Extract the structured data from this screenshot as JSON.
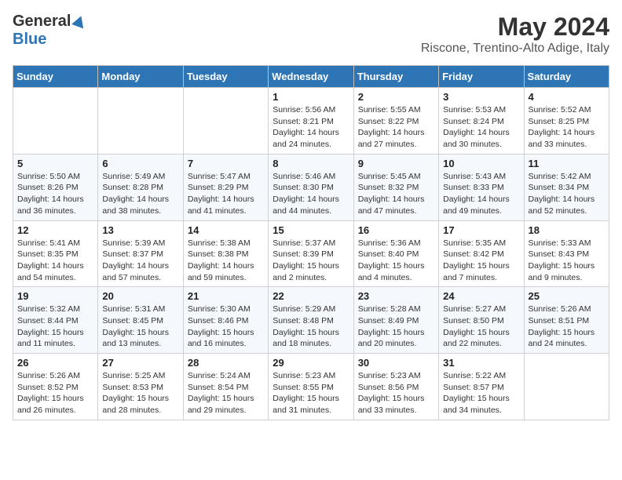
{
  "header": {
    "logo_general": "General",
    "logo_blue": "Blue",
    "month": "May 2024",
    "location": "Riscone, Trentino-Alto Adige, Italy"
  },
  "days_of_week": [
    "Sunday",
    "Monday",
    "Tuesday",
    "Wednesday",
    "Thursday",
    "Friday",
    "Saturday"
  ],
  "weeks": [
    [
      {
        "day": "",
        "sunrise": "",
        "sunset": "",
        "daylight": ""
      },
      {
        "day": "",
        "sunrise": "",
        "sunset": "",
        "daylight": ""
      },
      {
        "day": "",
        "sunrise": "",
        "sunset": "",
        "daylight": ""
      },
      {
        "day": "1",
        "sunrise": "Sunrise: 5:56 AM",
        "sunset": "Sunset: 8:21 PM",
        "daylight": "Daylight: 14 hours and 24 minutes."
      },
      {
        "day": "2",
        "sunrise": "Sunrise: 5:55 AM",
        "sunset": "Sunset: 8:22 PM",
        "daylight": "Daylight: 14 hours and 27 minutes."
      },
      {
        "day": "3",
        "sunrise": "Sunrise: 5:53 AM",
        "sunset": "Sunset: 8:24 PM",
        "daylight": "Daylight: 14 hours and 30 minutes."
      },
      {
        "day": "4",
        "sunrise": "Sunrise: 5:52 AM",
        "sunset": "Sunset: 8:25 PM",
        "daylight": "Daylight: 14 hours and 33 minutes."
      }
    ],
    [
      {
        "day": "5",
        "sunrise": "Sunrise: 5:50 AM",
        "sunset": "Sunset: 8:26 PM",
        "daylight": "Daylight: 14 hours and 36 minutes."
      },
      {
        "day": "6",
        "sunrise": "Sunrise: 5:49 AM",
        "sunset": "Sunset: 8:28 PM",
        "daylight": "Daylight: 14 hours and 38 minutes."
      },
      {
        "day": "7",
        "sunrise": "Sunrise: 5:47 AM",
        "sunset": "Sunset: 8:29 PM",
        "daylight": "Daylight: 14 hours and 41 minutes."
      },
      {
        "day": "8",
        "sunrise": "Sunrise: 5:46 AM",
        "sunset": "Sunset: 8:30 PM",
        "daylight": "Daylight: 14 hours and 44 minutes."
      },
      {
        "day": "9",
        "sunrise": "Sunrise: 5:45 AM",
        "sunset": "Sunset: 8:32 PM",
        "daylight": "Daylight: 14 hours and 47 minutes."
      },
      {
        "day": "10",
        "sunrise": "Sunrise: 5:43 AM",
        "sunset": "Sunset: 8:33 PM",
        "daylight": "Daylight: 14 hours and 49 minutes."
      },
      {
        "day": "11",
        "sunrise": "Sunrise: 5:42 AM",
        "sunset": "Sunset: 8:34 PM",
        "daylight": "Daylight: 14 hours and 52 minutes."
      }
    ],
    [
      {
        "day": "12",
        "sunrise": "Sunrise: 5:41 AM",
        "sunset": "Sunset: 8:35 PM",
        "daylight": "Daylight: 14 hours and 54 minutes."
      },
      {
        "day": "13",
        "sunrise": "Sunrise: 5:39 AM",
        "sunset": "Sunset: 8:37 PM",
        "daylight": "Daylight: 14 hours and 57 minutes."
      },
      {
        "day": "14",
        "sunrise": "Sunrise: 5:38 AM",
        "sunset": "Sunset: 8:38 PM",
        "daylight": "Daylight: 14 hours and 59 minutes."
      },
      {
        "day": "15",
        "sunrise": "Sunrise: 5:37 AM",
        "sunset": "Sunset: 8:39 PM",
        "daylight": "Daylight: 15 hours and 2 minutes."
      },
      {
        "day": "16",
        "sunrise": "Sunrise: 5:36 AM",
        "sunset": "Sunset: 8:40 PM",
        "daylight": "Daylight: 15 hours and 4 minutes."
      },
      {
        "day": "17",
        "sunrise": "Sunrise: 5:35 AM",
        "sunset": "Sunset: 8:42 PM",
        "daylight": "Daylight: 15 hours and 7 minutes."
      },
      {
        "day": "18",
        "sunrise": "Sunrise: 5:33 AM",
        "sunset": "Sunset: 8:43 PM",
        "daylight": "Daylight: 15 hours and 9 minutes."
      }
    ],
    [
      {
        "day": "19",
        "sunrise": "Sunrise: 5:32 AM",
        "sunset": "Sunset: 8:44 PM",
        "daylight": "Daylight: 15 hours and 11 minutes."
      },
      {
        "day": "20",
        "sunrise": "Sunrise: 5:31 AM",
        "sunset": "Sunset: 8:45 PM",
        "daylight": "Daylight: 15 hours and 13 minutes."
      },
      {
        "day": "21",
        "sunrise": "Sunrise: 5:30 AM",
        "sunset": "Sunset: 8:46 PM",
        "daylight": "Daylight: 15 hours and 16 minutes."
      },
      {
        "day": "22",
        "sunrise": "Sunrise: 5:29 AM",
        "sunset": "Sunset: 8:48 PM",
        "daylight": "Daylight: 15 hours and 18 minutes."
      },
      {
        "day": "23",
        "sunrise": "Sunrise: 5:28 AM",
        "sunset": "Sunset: 8:49 PM",
        "daylight": "Daylight: 15 hours and 20 minutes."
      },
      {
        "day": "24",
        "sunrise": "Sunrise: 5:27 AM",
        "sunset": "Sunset: 8:50 PM",
        "daylight": "Daylight: 15 hours and 22 minutes."
      },
      {
        "day": "25",
        "sunrise": "Sunrise: 5:26 AM",
        "sunset": "Sunset: 8:51 PM",
        "daylight": "Daylight: 15 hours and 24 minutes."
      }
    ],
    [
      {
        "day": "26",
        "sunrise": "Sunrise: 5:26 AM",
        "sunset": "Sunset: 8:52 PM",
        "daylight": "Daylight: 15 hours and 26 minutes."
      },
      {
        "day": "27",
        "sunrise": "Sunrise: 5:25 AM",
        "sunset": "Sunset: 8:53 PM",
        "daylight": "Daylight: 15 hours and 28 minutes."
      },
      {
        "day": "28",
        "sunrise": "Sunrise: 5:24 AM",
        "sunset": "Sunset: 8:54 PM",
        "daylight": "Daylight: 15 hours and 29 minutes."
      },
      {
        "day": "29",
        "sunrise": "Sunrise: 5:23 AM",
        "sunset": "Sunset: 8:55 PM",
        "daylight": "Daylight: 15 hours and 31 minutes."
      },
      {
        "day": "30",
        "sunrise": "Sunrise: 5:23 AM",
        "sunset": "Sunset: 8:56 PM",
        "daylight": "Daylight: 15 hours and 33 minutes."
      },
      {
        "day": "31",
        "sunrise": "Sunrise: 5:22 AM",
        "sunset": "Sunset: 8:57 PM",
        "daylight": "Daylight: 15 hours and 34 minutes."
      },
      {
        "day": "",
        "sunrise": "",
        "sunset": "",
        "daylight": ""
      }
    ]
  ]
}
